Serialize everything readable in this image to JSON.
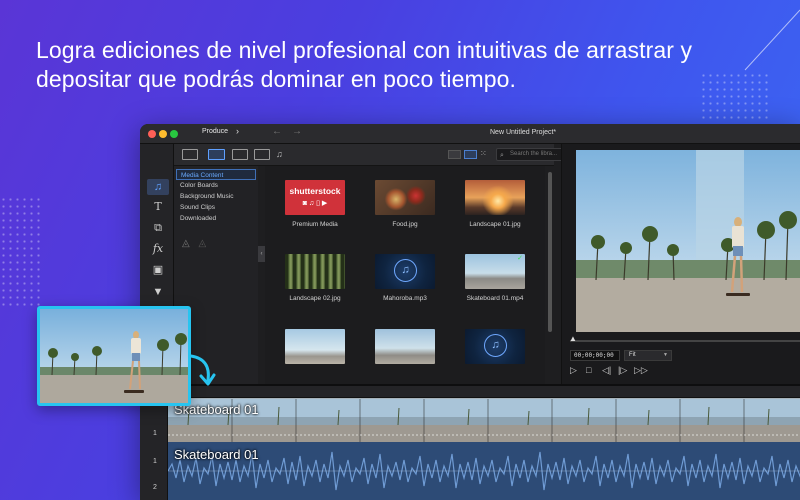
{
  "headline": "Logra ediciones de nivel profesional con intuitivas de arrastrar y depositar que podrás dominar en poco tiempo.",
  "colors": {
    "background_start": "#5a35d6",
    "background_end": "#3a6cf4",
    "accent": "#27c4f0",
    "app_bg": "#1e1e20",
    "selection_blue": "#5fa0ff"
  },
  "app": {
    "window_title": "New Untitled Project*",
    "produce_label": "Produce",
    "produce_icon": "chevron-right-icon",
    "search_placeholder": "Search the libra...",
    "side_icons": [
      "media-library-icon",
      "title-text-icon",
      "transition-icon",
      "fx-icon",
      "pip-icon",
      "mask-icon"
    ],
    "categories": [
      {
        "label": "Media Content",
        "active": true
      },
      {
        "label": "Color Boards",
        "active": false
      },
      {
        "label": "Background Music",
        "active": false
      },
      {
        "label": "Sound Clips",
        "active": false
      },
      {
        "label": "Downloaded",
        "active": false
      }
    ],
    "media_items": [
      {
        "label": "Premium Media",
        "kind": "shutterstock",
        "brand": "shutterstock"
      },
      {
        "label": "Food.jpg",
        "kind": "food"
      },
      {
        "label": "Landscape 01.jpg",
        "kind": "sunset"
      },
      {
        "label": "Landscape 02.jpg",
        "kind": "forest"
      },
      {
        "label": "Mahoroba.mp3",
        "kind": "music"
      },
      {
        "label": "Skateboard 01.mp4",
        "kind": "skate"
      }
    ],
    "preview": {
      "timecode": "00;00;00;00",
      "zoom": "Fit"
    },
    "timeline": {
      "tracks": [
        "1",
        "1",
        "2"
      ],
      "video_clip_label": "Skateboard 01",
      "audio_clip_label": "Skateboard 01"
    }
  }
}
